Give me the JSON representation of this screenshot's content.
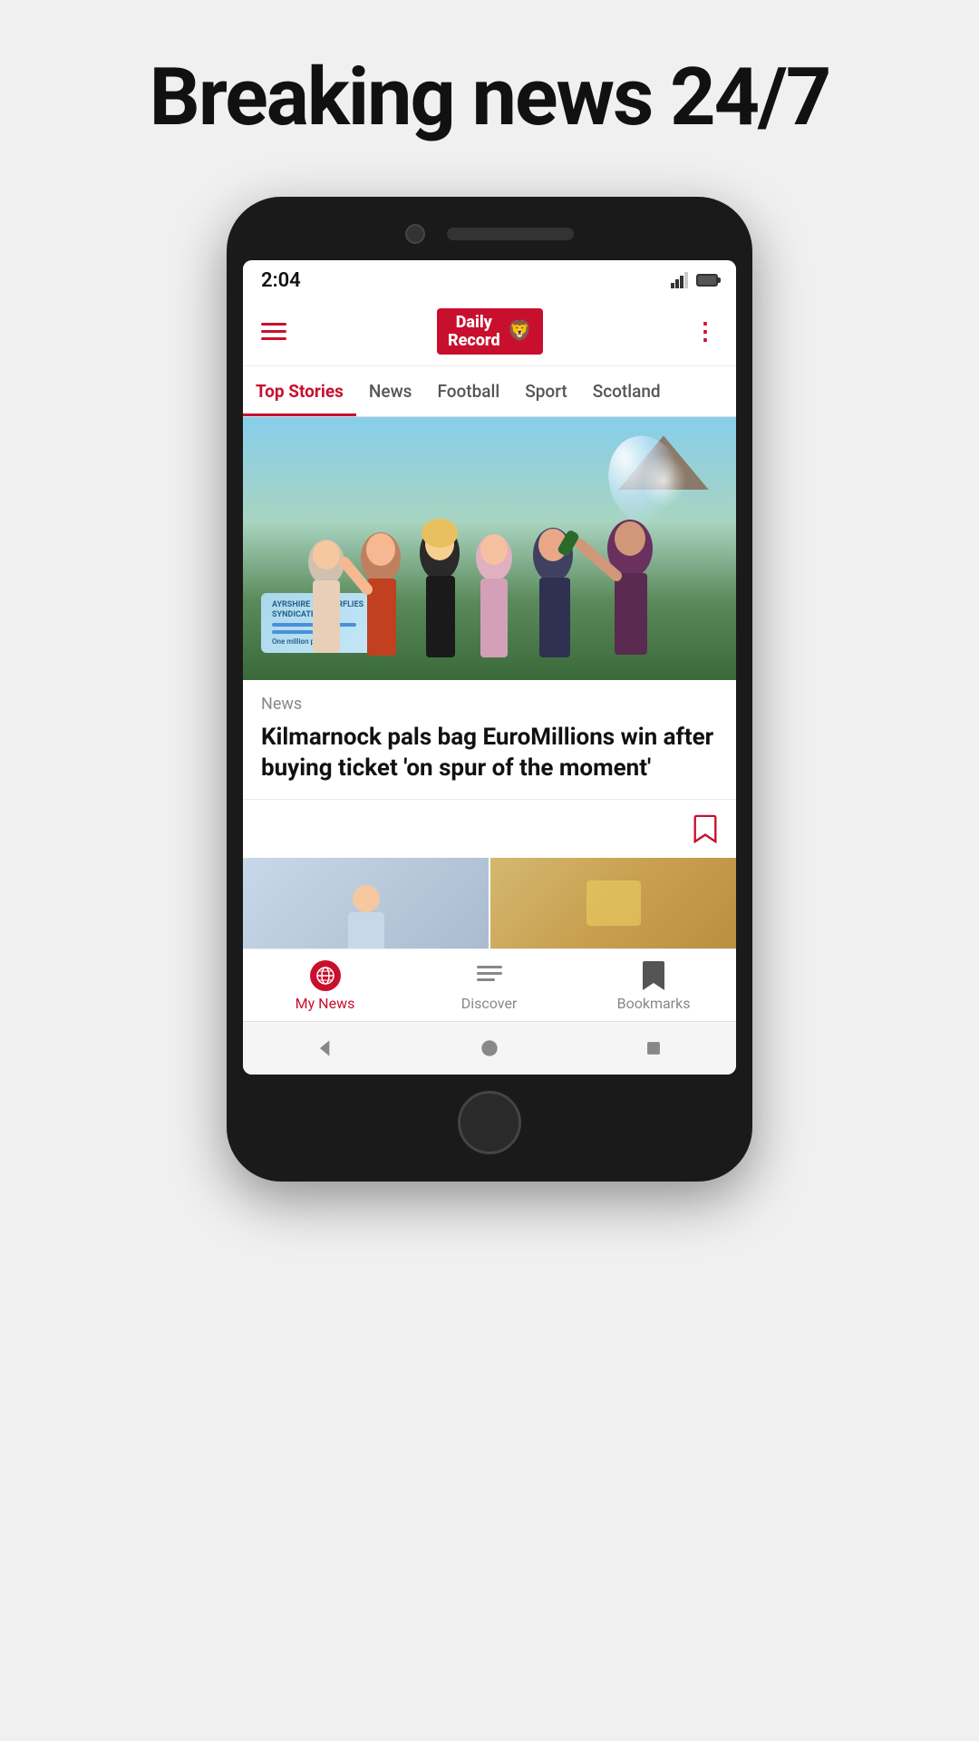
{
  "page": {
    "headline": "Breaking news 24/7"
  },
  "status_bar": {
    "time": "2:04"
  },
  "app_header": {
    "logo_line1": "Daily",
    "logo_line2": "Record"
  },
  "nav_tabs": [
    {
      "label": "Top Stories",
      "active": true
    },
    {
      "label": "News",
      "active": false
    },
    {
      "label": "Football",
      "active": false
    },
    {
      "label": "Sport",
      "active": false
    },
    {
      "label": "Scotland",
      "active": false
    }
  ],
  "article": {
    "category": "News",
    "title": "Kilmarnock pals bag EuroMillions win after buying ticket 'on spur of the moment'"
  },
  "bottom_nav": {
    "items": [
      {
        "label": "My News",
        "active": true
      },
      {
        "label": "Discover",
        "active": false
      },
      {
        "label": "Bookmarks",
        "active": false
      }
    ]
  }
}
